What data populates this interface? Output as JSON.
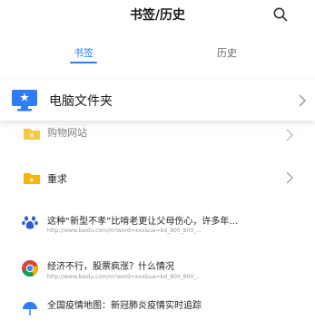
{
  "header": {
    "title": "书签/历史"
  },
  "tabs": [
    {
      "label": "书签"
    },
    {
      "label": "历史"
    }
  ],
  "computer_folder": {
    "label": "电脑文件夹"
  },
  "folders": [
    {
      "label": "购物网站"
    },
    {
      "label": "重求"
    }
  ],
  "bookmarks": [
    {
      "title": "这种“新型不孝”比啃老更让父母伤心，许多年…",
      "url": "http://www.baidu.com/m?word=xxx&ua=bd_800_800_..."
    },
    {
      "title": "经济不行，股票疯涨？什么情况",
      "url": "http://www.baidu.com/m?word=xxx&ua=bd_800_800_..."
    },
    {
      "title": "全国疫情地图：新冠肺炎疫情实时追踪",
      "url": ""
    }
  ],
  "colors": {
    "accent": "#2f7cf6",
    "folder": "#f5b50a"
  }
}
